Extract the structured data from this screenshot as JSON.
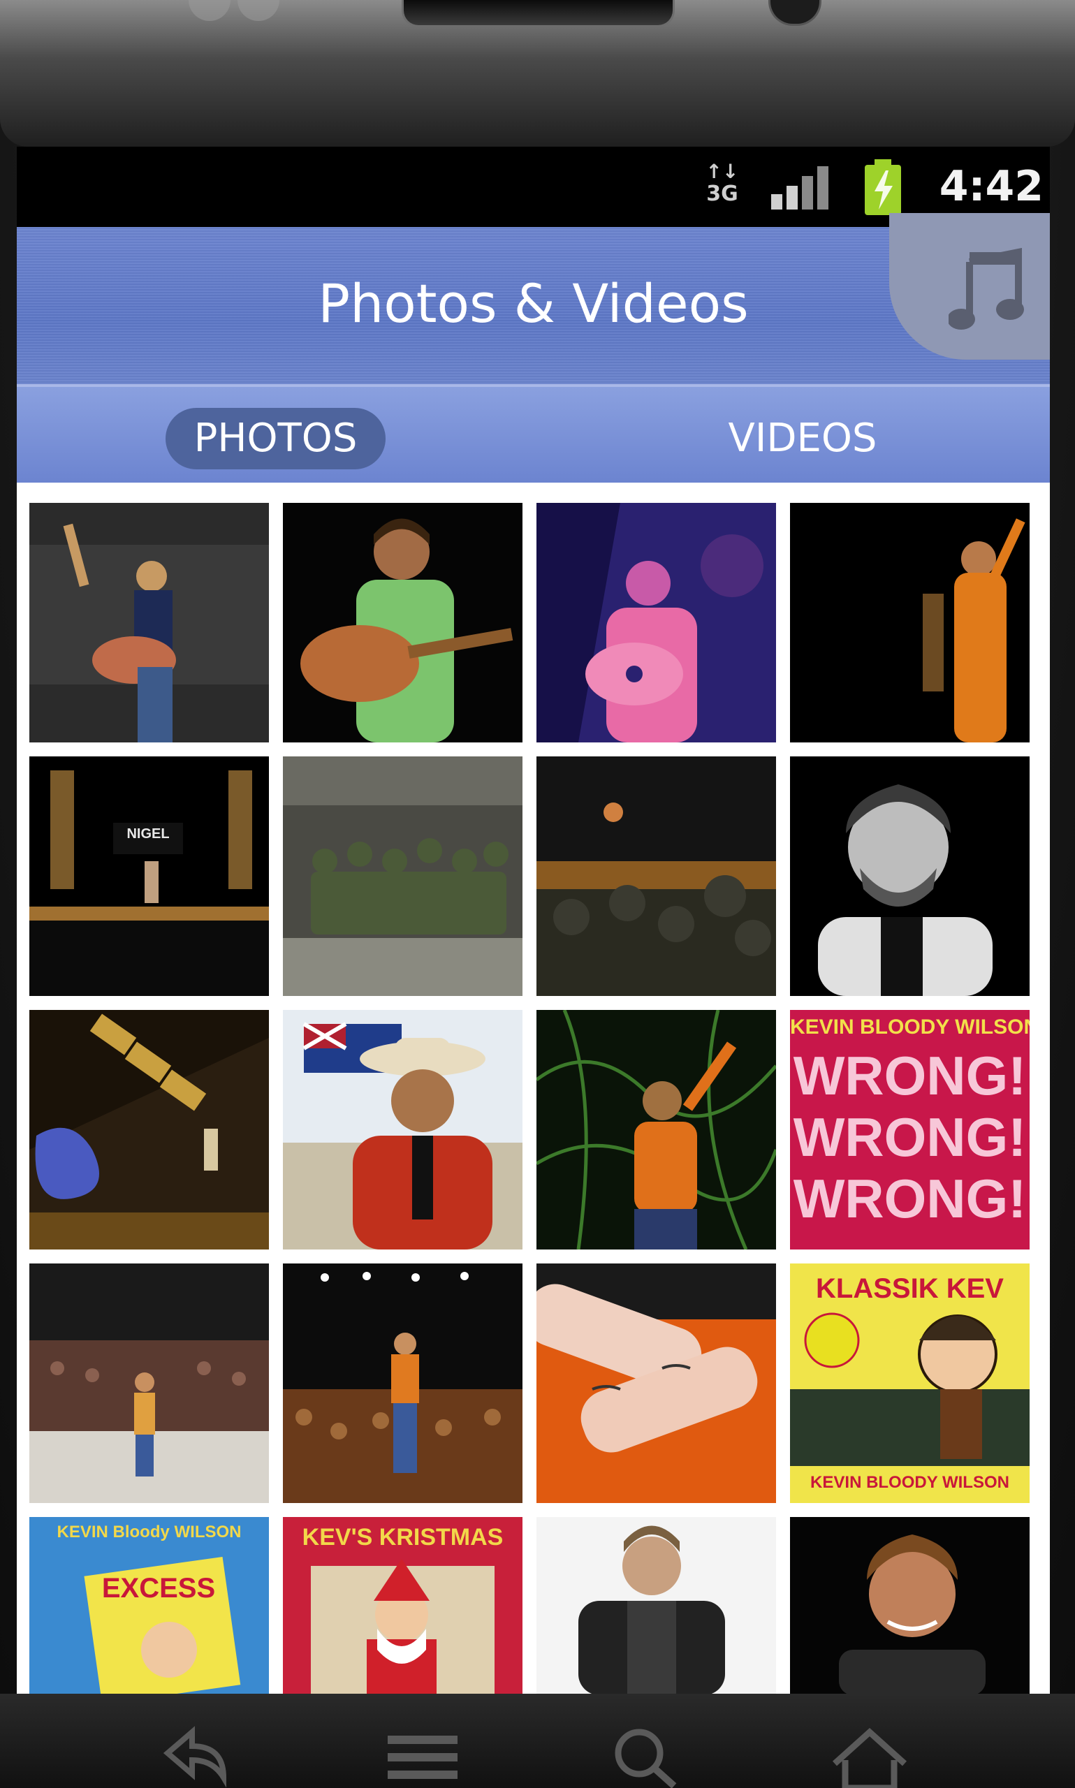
{
  "status_bar": {
    "network": "3G",
    "network_arrows": "↑↓",
    "time": "4:42",
    "battery_color": "#9ed22a"
  },
  "header": {
    "title": "Photos & Videos",
    "corner_icon": "music-note-icon"
  },
  "tabs": [
    {
      "label": "PHOTOS",
      "selected": true
    },
    {
      "label": "VIDEOS",
      "selected": false
    }
  ],
  "photo_covers": {
    "nigel_sign": "NIGEL",
    "wrong_cover_top": "KEVIN BLOODY WILSON",
    "wrong_cover_line1": "WRONG!",
    "wrong_cover_line2": "WRONG!",
    "wrong_cover_line3": "WRONG!",
    "klassik_title": "KLASSIK KEV",
    "klassik_artist": "KEVIN BLOODY WILSON",
    "excess_artist": "KEVIN Bloody WILSON",
    "excess_title": "EXCESS",
    "kevs_xmas_title": "KEV'S KRISTMAS"
  },
  "nav": {
    "back": "back-icon",
    "menu": "menu-icon",
    "search": "search-icon",
    "home": "home-icon"
  },
  "colors": {
    "header_blue": "#6179c6",
    "tab_selected": "#4e649d",
    "status_bar": "#000000"
  }
}
